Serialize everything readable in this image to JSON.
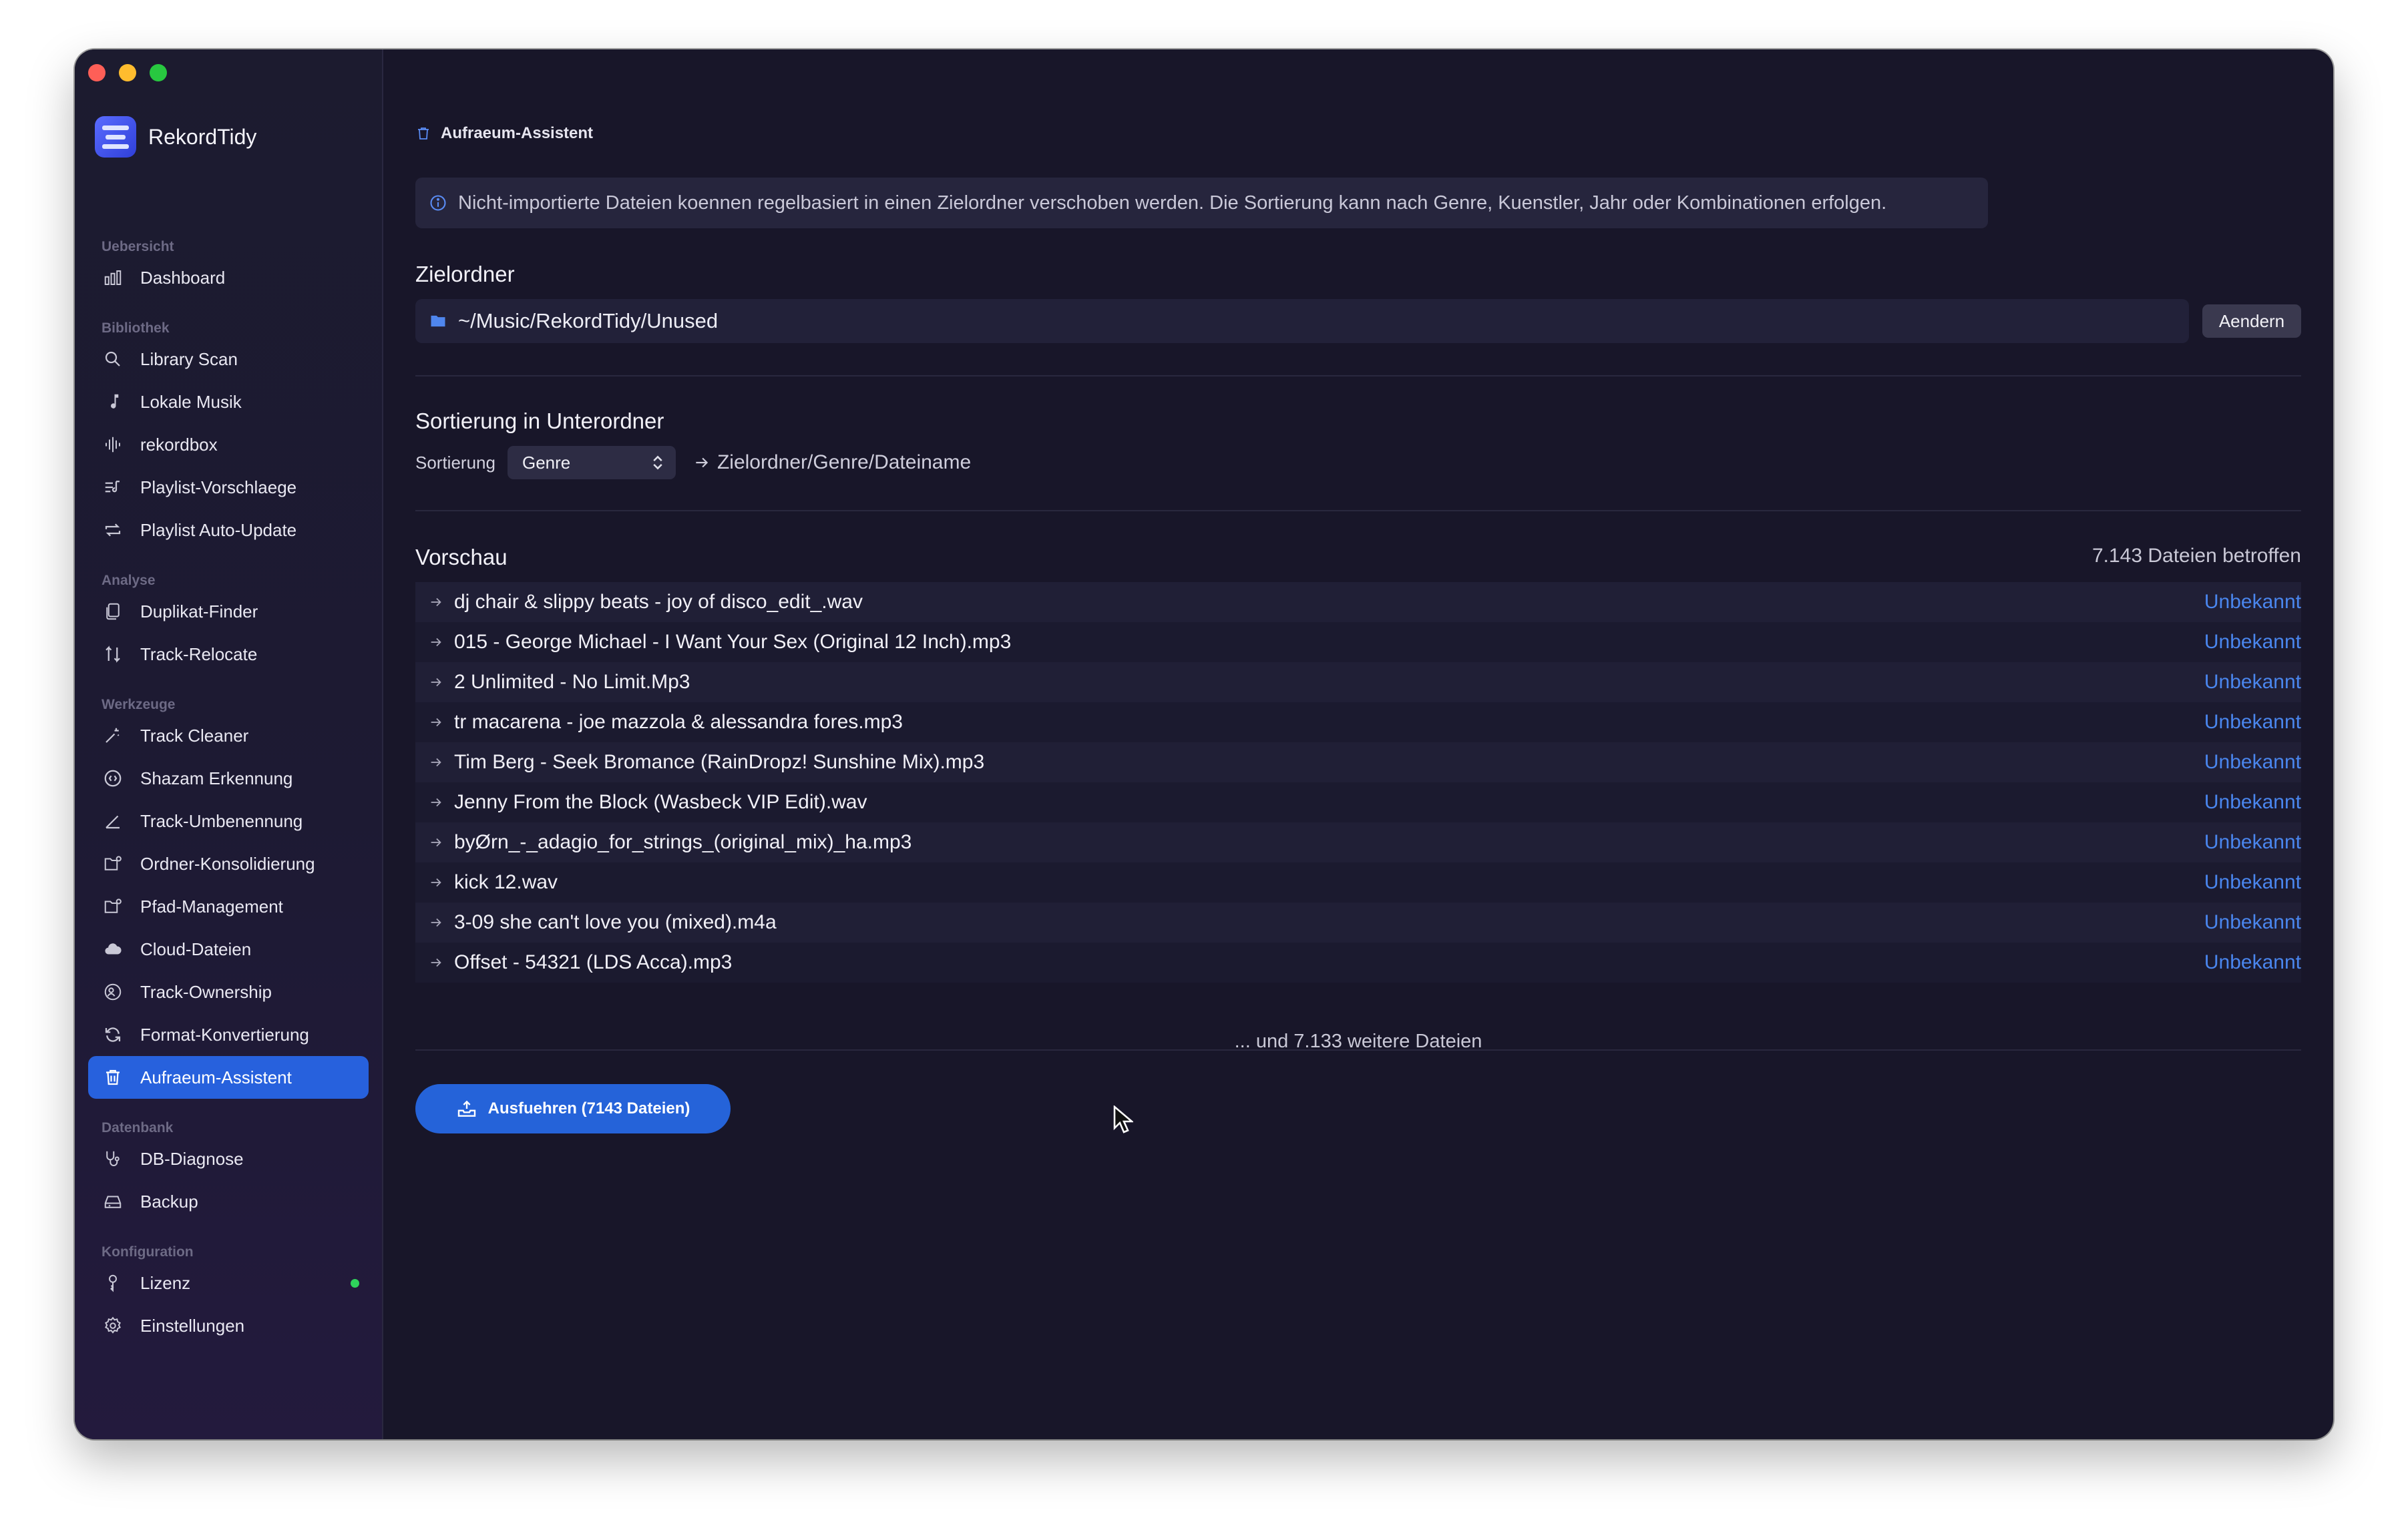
{
  "app": {
    "name": "RekordTidy"
  },
  "sidebar": {
    "sections": [
      {
        "title": "Uebersicht",
        "items": [
          {
            "label": "Dashboard",
            "icon": "bar-chart-icon"
          }
        ]
      },
      {
        "title": "Bibliothek",
        "items": [
          {
            "label": "Library Scan",
            "icon": "search-icon"
          },
          {
            "label": "Lokale Musik",
            "icon": "music-note-icon"
          },
          {
            "label": "rekordbox",
            "icon": "waveform-icon"
          },
          {
            "label": "Playlist-Vorschlaege",
            "icon": "playlist-icon"
          },
          {
            "label": "Playlist Auto-Update",
            "icon": "repeat-icon"
          }
        ]
      },
      {
        "title": "Analyse",
        "items": [
          {
            "label": "Duplikat-Finder",
            "icon": "duplicate-icon"
          },
          {
            "label": "Track-Relocate",
            "icon": "relocate-icon"
          }
        ]
      },
      {
        "title": "Werkzeuge",
        "items": [
          {
            "label": "Track Cleaner",
            "icon": "magic-wand-icon"
          },
          {
            "label": "Shazam Erkennung",
            "icon": "shazam-icon"
          },
          {
            "label": "Track-Umbenennung",
            "icon": "pencil-icon"
          },
          {
            "label": "Ordner-Konsolidierung",
            "icon": "folder-merge-icon"
          },
          {
            "label": "Pfad-Management",
            "icon": "folder-path-icon"
          },
          {
            "label": "Cloud-Dateien",
            "icon": "cloud-icon"
          },
          {
            "label": "Track-Ownership",
            "icon": "ownership-icon"
          },
          {
            "label": "Format-Konvertierung",
            "icon": "convert-icon"
          },
          {
            "label": "Aufraeum-Assistent",
            "icon": "trash-icon",
            "active": true
          }
        ]
      },
      {
        "title": "Datenbank",
        "items": [
          {
            "label": "DB-Diagnose",
            "icon": "stethoscope-icon"
          },
          {
            "label": "Backup",
            "icon": "backup-icon"
          }
        ]
      },
      {
        "title": "Konfiguration",
        "items": [
          {
            "label": "Lizenz",
            "icon": "key-icon",
            "status": "active"
          },
          {
            "label": "Einstellungen",
            "icon": "gear-icon"
          }
        ]
      }
    ]
  },
  "main": {
    "breadcrumb": "Aufraeum-Assistent",
    "info_text": "Nicht-importierte Dateien koennen regelbasiert in einen Zielordner verschoben werden. Die Sortierung kann nach Genre, Kuenstler, Jahr oder Kombinationen erfolgen.",
    "target": {
      "heading": "Zielordner",
      "path": "~/Music/RekordTidy/Unused",
      "change_label": "Aendern"
    },
    "sorting": {
      "heading": "Sortierung in Unterordner",
      "label": "Sortierung",
      "selected": "Genre",
      "result_path": "Zielordner/Genre/Dateiname"
    },
    "preview": {
      "heading": "Vorschau",
      "count_text": "7.143 Dateien betroffen",
      "files": [
        {
          "name": "dj chair & slippy beats - joy of disco_edit_.wav",
          "genre": "Unbekannt"
        },
        {
          "name": "015 - George Michael - I Want Your Sex (Original 12 Inch).mp3",
          "genre": "Unbekannt"
        },
        {
          "name": "2 Unlimited - No Limit.Mp3",
          "genre": "Unbekannt"
        },
        {
          "name": "tr macarena - joe mazzola & alessandra fores.mp3",
          "genre": "Unbekannt"
        },
        {
          "name": "Tim Berg - Seek Bromance (RainDropz! Sunshine Mix).mp3",
          "genre": "Unbekannt"
        },
        {
          "name": "Jenny From the Block (Wasbeck VIP Edit).wav",
          "genre": "Unbekannt"
        },
        {
          "name": "byØrn_-_adagio_for_strings_(original_mix)_ha.mp3",
          "genre": "Unbekannt"
        },
        {
          "name": "kick 12.wav",
          "genre": "Unbekannt"
        },
        {
          "name": "3-09 she can't love you (mixed).m4a",
          "genre": "Unbekannt"
        },
        {
          "name": "Offset - 54321 (LDS Acca).mp3",
          "genre": "Unbekannt"
        }
      ],
      "more_text": "... und 7.133 weitere Dateien"
    },
    "run_button_label": "Ausfuehren (7143 Dateien)"
  },
  "colors": {
    "accent": "#2761dd",
    "link": "#4a86ee",
    "status_dot": "#2fd35b",
    "background": "#181629"
  }
}
